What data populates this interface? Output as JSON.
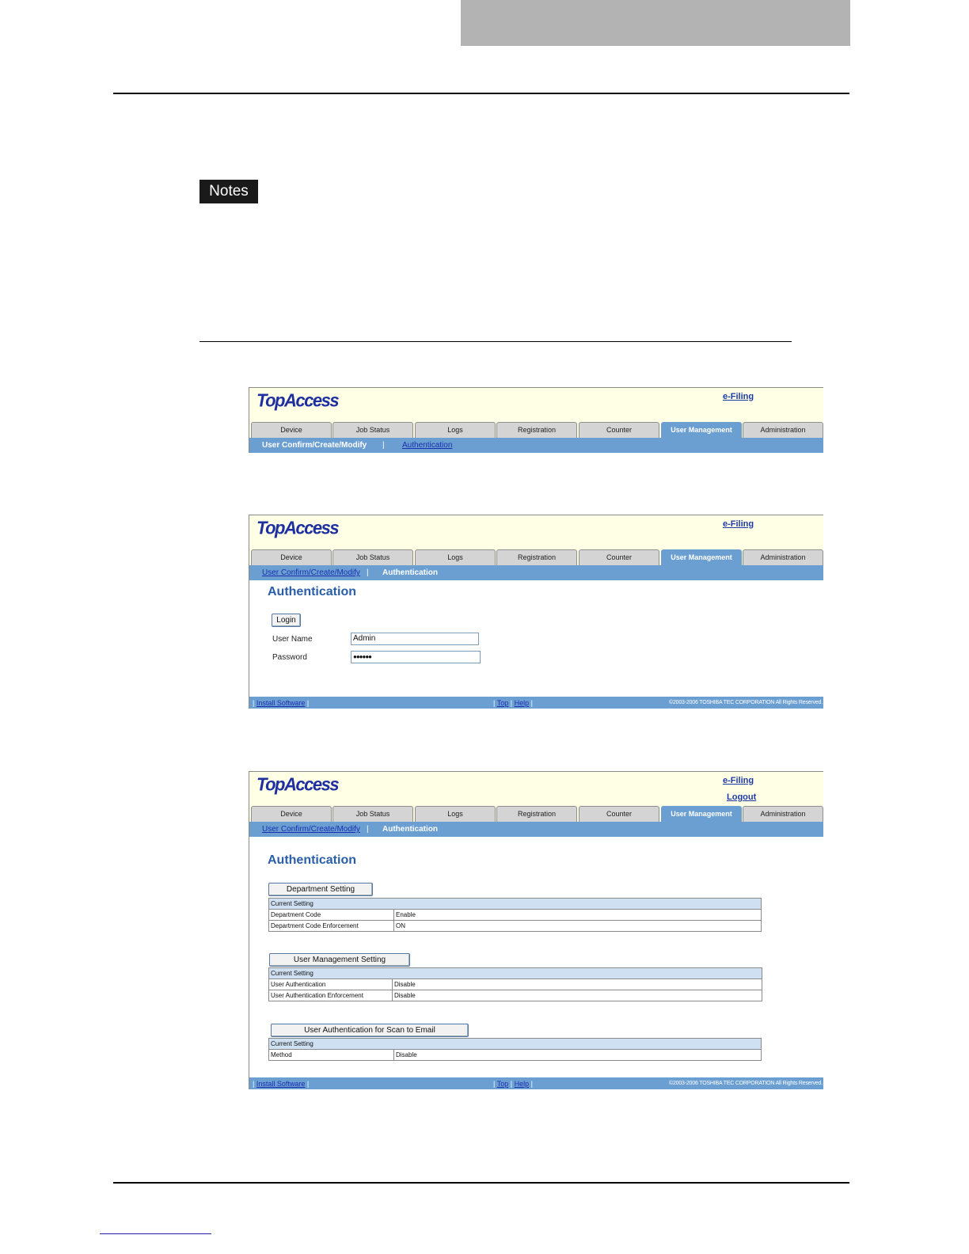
{
  "page": {
    "notes_label": "Notes"
  },
  "topaccess": {
    "logo": "TopAccess",
    "efiling": "e-Filing",
    "logout": "Logout",
    "tabs": [
      "Device",
      "Job Status",
      "Logs",
      "Registration",
      "Counter",
      "User Management",
      "Administration"
    ],
    "subnav": {
      "user_confirm": "User Confirm/Create/Modify",
      "separator": "|",
      "authentication": "Authentication"
    },
    "footer": {
      "install_software": "Install Software",
      "top": "Top",
      "help": "Help",
      "bar": "|",
      "copyright": "©2003-2006 TOSHIBA TEC CORPORATION All Rights Reserved."
    }
  },
  "login_screen": {
    "title": "Authentication",
    "login_button": "Login",
    "user_name_label": "User Name",
    "user_name_value": "Admin",
    "password_label": "Password",
    "password_value": "●●●●●●"
  },
  "settings_screen": {
    "title": "Authentication",
    "department": {
      "button": "Department Setting",
      "header": "Current Setting",
      "rows": [
        {
          "label": "Department Code",
          "value": "Enable"
        },
        {
          "label": "Department Code Enforcement",
          "value": "ON"
        }
      ]
    },
    "user_management": {
      "button": "User Management Setting",
      "header": "Current Setting",
      "rows": [
        {
          "label": "User Authentication",
          "value": "Disable"
        },
        {
          "label": "User Authentication Enforcement",
          "value": "Disable"
        }
      ]
    },
    "scan_to_email": {
      "button": "User Authentication for Scan to Email",
      "header": "Current Setting",
      "rows": [
        {
          "label": "Method",
          "value": "Disable"
        }
      ]
    }
  }
}
